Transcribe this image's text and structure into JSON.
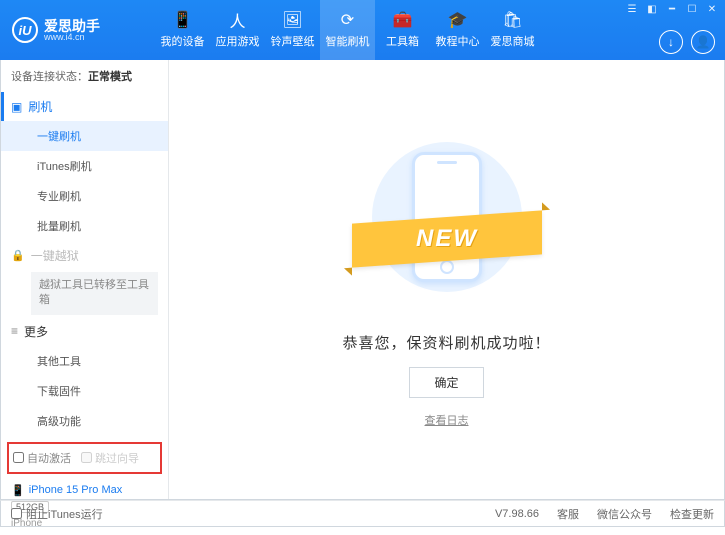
{
  "logo": {
    "name": "爱思助手",
    "url": "www.i4.cn",
    "badge": "iU"
  },
  "nav": [
    {
      "label": "我的设备"
    },
    {
      "label": "应用游戏"
    },
    {
      "label": "铃声壁纸"
    },
    {
      "label": "智能刷机"
    },
    {
      "label": "工具箱"
    },
    {
      "label": "教程中心"
    },
    {
      "label": "爱思商城"
    }
  ],
  "status": {
    "label": "设备连接状态：",
    "value": "正常模式"
  },
  "sidebar": {
    "flash_section": "刷机",
    "items": {
      "onekey": "一键刷机",
      "itunes": "iTunes刷机",
      "pro": "专业刷机",
      "batch": "批量刷机"
    },
    "jailbreak_section": "一键越狱",
    "jailbreak_note": "越狱工具已转移至工具箱",
    "more_section": "更多",
    "more": {
      "other": "其他工具",
      "download": "下载固件",
      "advanced": "高级功能"
    },
    "checks": {
      "auto_activate": "自动激活",
      "skip_wizard": "跳过向导"
    }
  },
  "device": {
    "name": "iPhone 15 Pro Max",
    "capacity": "512GB",
    "type": "iPhone"
  },
  "main": {
    "ribbon": "NEW",
    "success": "恭喜您，保资料刷机成功啦！",
    "ok": "确定",
    "log": "查看日志"
  },
  "footer": {
    "block_itunes": "阻止iTunes运行",
    "version": "V7.98.66",
    "links": {
      "service": "客服",
      "wechat": "微信公众号",
      "update": "检查更新"
    }
  }
}
